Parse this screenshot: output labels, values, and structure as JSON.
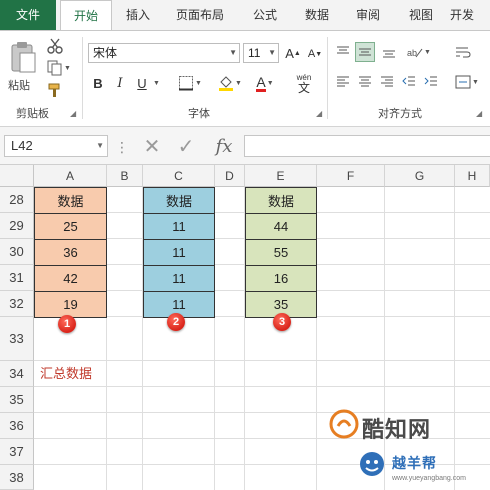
{
  "ribbon_tabs": [
    "文件",
    "开始",
    "插入",
    "页面布局",
    "公式",
    "数据",
    "审阅",
    "视图",
    "开发"
  ],
  "active_tab": "开始",
  "clipboard": {
    "paste_label": "粘贴",
    "group_label": "剪贴板"
  },
  "font": {
    "name": "宋体",
    "size": "11",
    "group_label": "字体",
    "bold": "B",
    "italic": "I",
    "underline": "U",
    "font_color_glyph": "A",
    "phonetic_glyph": "wén"
  },
  "alignment": {
    "group_label": "对齐方式"
  },
  "formula_bar": {
    "name_box": "L42",
    "cancel_glyph": "✕",
    "enter_glyph": "✓",
    "fx_label": "fx",
    "value": ""
  },
  "columns": [
    "A",
    "B",
    "C",
    "D",
    "E",
    "F",
    "G",
    "H"
  ],
  "rows": [
    "28",
    "29",
    "30",
    "31",
    "32",
    "33",
    "34",
    "35",
    "36",
    "37",
    "38"
  ],
  "tables": [
    {
      "column": "A",
      "header": "数据",
      "values": [
        "25",
        "36",
        "42",
        "19"
      ],
      "color": "#f8cbad",
      "marker": "1"
    },
    {
      "column": "C",
      "header": "数据",
      "values": [
        "11",
        "11",
        "11",
        "11"
      ],
      "color": "#9dcfdf",
      "marker": "2"
    },
    {
      "column": "E",
      "header": "数据",
      "values": [
        "44",
        "55",
        "16",
        "35"
      ],
      "color": "#d8e4bc",
      "marker": "3"
    }
  ],
  "summary_label": "汇总数据",
  "summary_color": "#c0392b",
  "accent_color": "#217346",
  "watermark": {
    "main": "酷知网",
    "sub": "越羊帮",
    "url": "www.yueyangbang.com"
  }
}
